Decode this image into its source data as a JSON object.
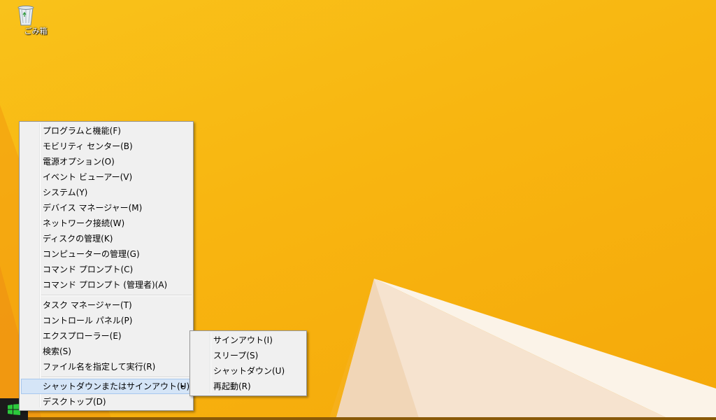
{
  "desktop": {
    "icons": [
      {
        "label": "ごみ箱",
        "icon": "recycle-bin-icon"
      }
    ]
  },
  "taskbar": {
    "start_icon": "windows-logo-icon"
  },
  "winx_menu": {
    "groups": [
      [
        "プログラムと機能(F)",
        "モビリティ センター(B)",
        "電源オプション(O)",
        "イベント ビューアー(V)",
        "システム(Y)",
        "デバイス マネージャー(M)",
        "ネットワーク接続(W)",
        "ディスクの管理(K)",
        "コンピューターの管理(G)",
        "コマンド プロンプト(C)",
        "コマンド プロンプト (管理者)(A)"
      ],
      [
        "タスク マネージャー(T)",
        "コントロール パネル(P)",
        "エクスプローラー(E)",
        "検索(S)",
        "ファイル名を指定して実行(R)"
      ],
      [
        "シャットダウンまたはサインアウト(U)",
        "デスクトップ(D)"
      ]
    ],
    "highlighted": "シャットダウンまたはサインアウト(U)",
    "submenu_arrow": "►"
  },
  "submenu": {
    "items": [
      "サインアウト(I)",
      "スリープ(S)",
      "シャットダウン(U)",
      "再起動(R)"
    ]
  },
  "colors": {
    "wallpaper": "#f8b510",
    "menu_bg": "#f0f0f0",
    "highlight": "#d5e5f7",
    "taskbar": "#1b1b1b"
  }
}
